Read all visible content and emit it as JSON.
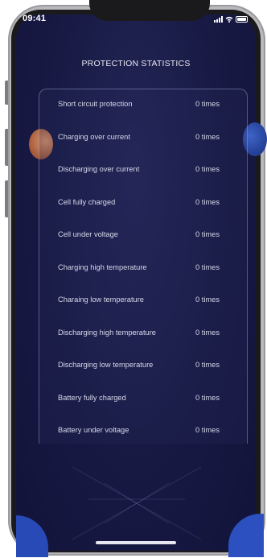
{
  "status_bar": {
    "time": "09:41",
    "signal_icon": "signal-bars-icon",
    "wifi_icon": "wifi-icon",
    "battery_icon": "battery-icon"
  },
  "page": {
    "title": "PROTECTION STATISTICS"
  },
  "stats": [
    {
      "label": "Short circuit protection",
      "value": "0 times"
    },
    {
      "label": "Charging over current",
      "value": "0 times"
    },
    {
      "label": "Discharging over current",
      "value": "0 times"
    },
    {
      "label": "Cell fully charged",
      "value": "0 times"
    },
    {
      "label": "Cell under voltage",
      "value": "0 times"
    },
    {
      "label": "Charging high temperature",
      "value": "0 times"
    },
    {
      "label": "Charaing low temperature",
      "value": "0 times"
    },
    {
      "label": "Discharging high temperature",
      "value": "0 times"
    },
    {
      "label": "Discharging low temperature",
      "value": "0 times"
    },
    {
      "label": "Battery fully charged",
      "value": "0 times"
    },
    {
      "label": "Battery under voltage",
      "value": "0 times"
    }
  ],
  "colors": {
    "background": "#171943",
    "accent_blue": "#2d50c0",
    "accent_orange": "#e49a6c",
    "text": "#d6d8ea"
  }
}
